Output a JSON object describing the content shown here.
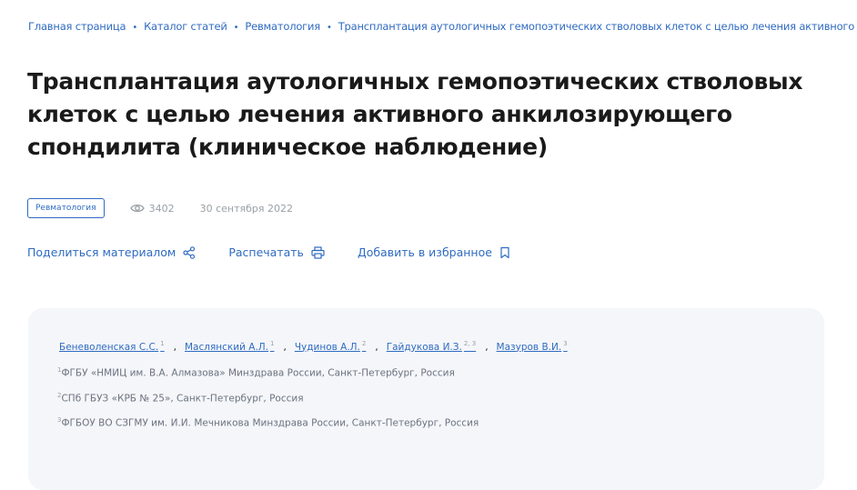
{
  "breadcrumb": [
    "Главная страница",
    "Каталог статей",
    "Ревматология",
    "Трансплантация аутологичных гемопоэтических стволовых клеток с целью лечения активного анкилозирующего спондилита"
  ],
  "breadcrumb_separator": "•",
  "title": "Трансплантация аутологичных гемопоэтических стволовых клеток с целью лечения активного анкилозирующего спондилита (клиническое наблюдение)",
  "meta": {
    "tag": "Ревматология",
    "views": "3402",
    "date": "30 сентября 2022"
  },
  "actions": {
    "share": "Поделиться материалом",
    "print": "Распечатать",
    "favorite": "Добавить в избранное"
  },
  "authors": [
    {
      "name": "Беневоленская С.С.",
      "sup": "1"
    },
    {
      "name": "Маслянский А.Л.",
      "sup": "1"
    },
    {
      "name": "Чудинов А.Л.",
      "sup": "2"
    },
    {
      "name": "Гайдукова И.З.",
      "sup": "2, 3"
    },
    {
      "name": "Мазуров В.И.",
      "sup": "3"
    }
  ],
  "author_separator": ",",
  "affiliations": [
    {
      "sup": "1",
      "text": "ФГБУ «НМИЦ им. В.А. Алмазова» Минздрава России, Санкт-Петербург, Россия"
    },
    {
      "sup": "2",
      "text": "СПб ГБУЗ «КРБ № 25», Санкт-Петербург, Россия"
    },
    {
      "sup": "3",
      "text": "ФГБОУ ВО СЗГМУ им. И.И. Мечникова Минздрава России, Санкт-Петербург, Россия"
    }
  ],
  "colors": {
    "link": "#2f6bc1",
    "muted": "#9aa0a6",
    "card_bg": "#f4f6f9",
    "title": "#1a1a1a"
  }
}
